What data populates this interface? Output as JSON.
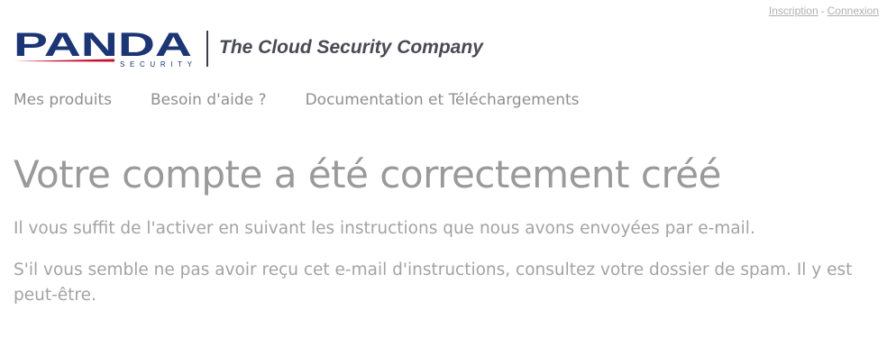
{
  "header": {
    "links": {
      "signup": "Inscription",
      "separator": "-",
      "login": "Connexion"
    },
    "logo": {
      "brand": "PANDA",
      "sub": "SECURITY",
      "colors": {
        "brand": "#1b3575",
        "swoosh": "#c8102e"
      }
    },
    "tagline": "The Cloud Security Company"
  },
  "nav": {
    "items": [
      {
        "label": "Mes produits"
      },
      {
        "label": "Besoin d'aide ?"
      },
      {
        "label": "Documentation et Téléchargements"
      }
    ]
  },
  "main": {
    "title": "Votre compte a été correctement créé",
    "paragraph1": "Il vous suffit de l'activer en suivant les instructions que nous avons envoyées par e-mail.",
    "paragraph2": "S'il vous semble ne pas avoir reçu cet e-mail d'instructions, consultez votre dossier de spam. Il y est peut-être."
  }
}
